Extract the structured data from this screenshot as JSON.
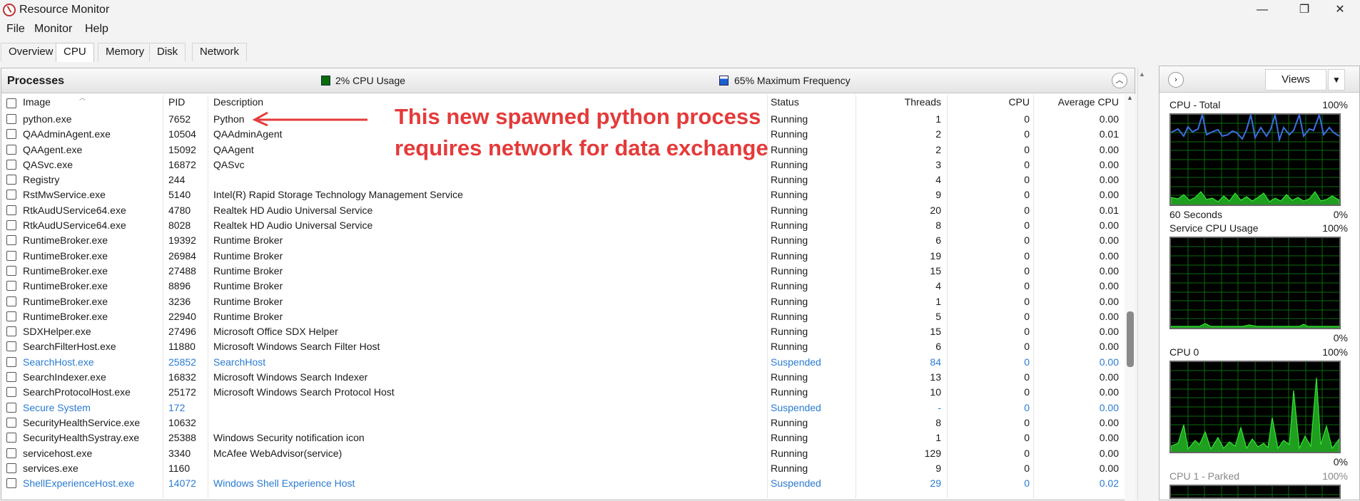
{
  "window": {
    "title": "Resource Monitor",
    "minimize": "—",
    "restore": "❐",
    "close": "✕"
  },
  "menu": [
    "File",
    "Monitor",
    "Help"
  ],
  "tabs": [
    "Overview",
    "CPU",
    "Memory",
    "Disk",
    "Network"
  ],
  "active_tab": "CPU",
  "processes": {
    "title": "Processes",
    "cpu_usage": "2% CPU Usage",
    "max_frequency": "65% Maximum Frequency",
    "columns": {
      "image": "Image",
      "pid": "PID",
      "description": "Description",
      "status": "Status",
      "threads": "Threads",
      "cpu": "CPU",
      "avg_cpu": "Average CPU"
    },
    "rows": [
      {
        "image": "python.exe",
        "pid": "7652",
        "desc": "Python",
        "status": "Running",
        "threads": "1",
        "cpu": "0",
        "avg": "0.00",
        "suspended": false
      },
      {
        "image": "QAAdminAgent.exe",
        "pid": "10504",
        "desc": "QAAdminAgent",
        "status": "Running",
        "threads": "2",
        "cpu": "0",
        "avg": "0.01",
        "suspended": false
      },
      {
        "image": "QAAgent.exe",
        "pid": "15092",
        "desc": "QAAgent",
        "status": "Running",
        "threads": "2",
        "cpu": "0",
        "avg": "0.00",
        "suspended": false
      },
      {
        "image": "QASvc.exe",
        "pid": "16872",
        "desc": "QASvc",
        "status": "Running",
        "threads": "3",
        "cpu": "0",
        "avg": "0.00",
        "suspended": false
      },
      {
        "image": "Registry",
        "pid": "244",
        "desc": "",
        "status": "Running",
        "threads": "4",
        "cpu": "0",
        "avg": "0.00",
        "suspended": false
      },
      {
        "image": "RstMwService.exe",
        "pid": "5140",
        "desc": "Intel(R) Rapid Storage Technology Management Service",
        "status": "Running",
        "threads": "9",
        "cpu": "0",
        "avg": "0.00",
        "suspended": false
      },
      {
        "image": "RtkAudUService64.exe",
        "pid": "4780",
        "desc": "Realtek HD Audio Universal Service",
        "status": "Running",
        "threads": "20",
        "cpu": "0",
        "avg": "0.01",
        "suspended": false
      },
      {
        "image": "RtkAudUService64.exe",
        "pid": "8028",
        "desc": "Realtek HD Audio Universal Service",
        "status": "Running",
        "threads": "8",
        "cpu": "0",
        "avg": "0.00",
        "suspended": false
      },
      {
        "image": "RuntimeBroker.exe",
        "pid": "19392",
        "desc": "Runtime Broker",
        "status": "Running",
        "threads": "6",
        "cpu": "0",
        "avg": "0.00",
        "suspended": false
      },
      {
        "image": "RuntimeBroker.exe",
        "pid": "26984",
        "desc": "Runtime Broker",
        "status": "Running",
        "threads": "19",
        "cpu": "0",
        "avg": "0.00",
        "suspended": false
      },
      {
        "image": "RuntimeBroker.exe",
        "pid": "27488",
        "desc": "Runtime Broker",
        "status": "Running",
        "threads": "15",
        "cpu": "0",
        "avg": "0.00",
        "suspended": false
      },
      {
        "image": "RuntimeBroker.exe",
        "pid": "8896",
        "desc": "Runtime Broker",
        "status": "Running",
        "threads": "4",
        "cpu": "0",
        "avg": "0.00",
        "suspended": false
      },
      {
        "image": "RuntimeBroker.exe",
        "pid": "3236",
        "desc": "Runtime Broker",
        "status": "Running",
        "threads": "1",
        "cpu": "0",
        "avg": "0.00",
        "suspended": false
      },
      {
        "image": "RuntimeBroker.exe",
        "pid": "22940",
        "desc": "Runtime Broker",
        "status": "Running",
        "threads": "5",
        "cpu": "0",
        "avg": "0.00",
        "suspended": false
      },
      {
        "image": "SDXHelper.exe",
        "pid": "27496",
        "desc": "Microsoft Office SDX Helper",
        "status": "Running",
        "threads": "15",
        "cpu": "0",
        "avg": "0.00",
        "suspended": false
      },
      {
        "image": "SearchFilterHost.exe",
        "pid": "11880",
        "desc": "Microsoft Windows Search Filter Host",
        "status": "Running",
        "threads": "6",
        "cpu": "0",
        "avg": "0.00",
        "suspended": false
      },
      {
        "image": "SearchHost.exe",
        "pid": "25852",
        "desc": "SearchHost",
        "status": "Suspended",
        "threads": "84",
        "cpu": "0",
        "avg": "0.00",
        "suspended": true
      },
      {
        "image": "SearchIndexer.exe",
        "pid": "16832",
        "desc": "Microsoft Windows Search Indexer",
        "status": "Running",
        "threads": "13",
        "cpu": "0",
        "avg": "0.00",
        "suspended": false
      },
      {
        "image": "SearchProtocolHost.exe",
        "pid": "25172",
        "desc": "Microsoft Windows Search Protocol Host",
        "status": "Running",
        "threads": "10",
        "cpu": "0",
        "avg": "0.00",
        "suspended": false
      },
      {
        "image": "Secure System",
        "pid": "172",
        "desc": "",
        "status": "Suspended",
        "threads": "-",
        "cpu": "0",
        "avg": "0.00",
        "suspended": true
      },
      {
        "image": "SecurityHealthService.exe",
        "pid": "10632",
        "desc": "",
        "status": "Running",
        "threads": "8",
        "cpu": "0",
        "avg": "0.00",
        "suspended": false
      },
      {
        "image": "SecurityHealthSystray.exe",
        "pid": "25388",
        "desc": "Windows Security notification icon",
        "status": "Running",
        "threads": "1",
        "cpu": "0",
        "avg": "0.00",
        "suspended": false
      },
      {
        "image": "servicehost.exe",
        "pid": "3340",
        "desc": "McAfee WebAdvisor(service)",
        "status": "Running",
        "threads": "129",
        "cpu": "0",
        "avg": "0.00",
        "suspended": false
      },
      {
        "image": "services.exe",
        "pid": "1160",
        "desc": "",
        "status": "Running",
        "threads": "9",
        "cpu": "0",
        "avg": "0.00",
        "suspended": false
      },
      {
        "image": "ShellExperienceHost.exe",
        "pid": "14072",
        "desc": "Windows Shell Experience Host",
        "status": "Suspended",
        "threads": "29",
        "cpu": "0",
        "avg": "0.02",
        "suspended": true
      }
    ]
  },
  "annotation": {
    "line1": "This new spawned python process",
    "line2": "requires network for data exchange",
    "color": "#e53a3a"
  },
  "right_panel": {
    "views_label": "Views",
    "graphs": [
      {
        "title": "CPU - Total",
        "max": "100%",
        "foot_left": "60 Seconds",
        "foot_right": "0%"
      },
      {
        "title": "Service CPU Usage",
        "max": "100%",
        "foot_left": "",
        "foot_right": "0%"
      },
      {
        "title": "CPU 0",
        "max": "100%",
        "foot_left": "",
        "foot_right": "0%"
      },
      {
        "title": "CPU 1 - Parked",
        "max": "100%",
        "foot_left": "",
        "foot_right": ""
      }
    ]
  }
}
